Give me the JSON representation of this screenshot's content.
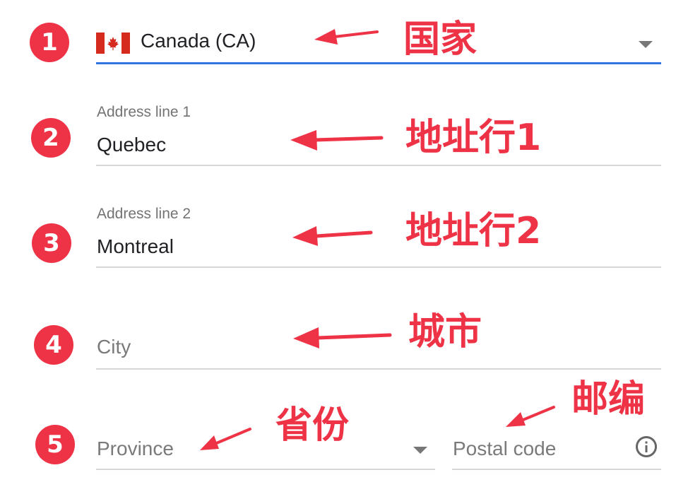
{
  "steps": {
    "country": "1",
    "address1": "2",
    "address2": "3",
    "city": "4",
    "province_postal": "5"
  },
  "form": {
    "country": {
      "value": "Canada (CA)",
      "flag": "canada-flag-icon",
      "active_color": "#2f74e0"
    },
    "address1": {
      "label": "Address line 1",
      "value": "Quebec"
    },
    "address2": {
      "label": "Address line 2",
      "value": "Montreal"
    },
    "city": {
      "placeholder": "City"
    },
    "province": {
      "placeholder": "Province"
    },
    "postal": {
      "placeholder": "Postal code",
      "icon": "info-icon"
    }
  },
  "annotations": {
    "country": "国家",
    "address1": "地址行1",
    "address2": "地址行2",
    "city": "城市",
    "province": "省份",
    "postal": "邮编",
    "color": "#ee3347"
  }
}
